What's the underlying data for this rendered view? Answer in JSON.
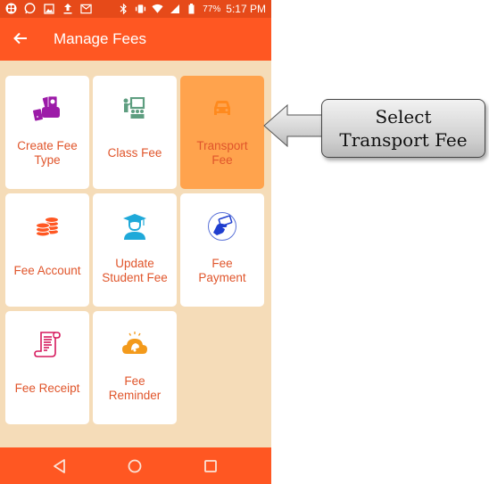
{
  "status_bar": {
    "left_icons": [
      "app-notification-icon",
      "whatsapp-icon",
      "image-icon",
      "upload-icon",
      "mail-icon"
    ],
    "right_icons": [
      "bluetooth-icon",
      "vibrate-icon",
      "wifi-icon",
      "signal-icon",
      "battery-icon"
    ],
    "battery": "77%",
    "time": "5:17 PM"
  },
  "app_bar": {
    "back_icon": "arrow-left-icon",
    "title": "Manage Fees"
  },
  "tiles": [
    {
      "label_line1": "Create Fee",
      "label_line2": "Type",
      "icon": "cash-hand-icon",
      "icon_color": "#9C1AA8"
    },
    {
      "label_line1": "Class Fee",
      "label_line2": "",
      "icon": "classroom-icon",
      "icon_color": "#5E9E80"
    },
    {
      "label_line1": "Transport",
      "label_line2": "Fee",
      "icon": "car-icon",
      "icon_color": "#FF8A1E",
      "selected": true
    },
    {
      "label_line1": "Fee Account",
      "label_line2": "",
      "icon": "coins-icon",
      "icon_color": "#FF5722"
    },
    {
      "label_line1": "Update",
      "label_line2": "Student Fee",
      "icon": "graduate-icon",
      "icon_color": "#1FA9D9"
    },
    {
      "label_line1": "Fee",
      "label_line2": "Payment",
      "icon": "card-payment-icon",
      "icon_color": "#1F3ECF"
    },
    {
      "label_line1": "Fee Receipt",
      "label_line2": "",
      "icon": "receipt-scroll-icon",
      "icon_color": "#D6195D"
    },
    {
      "label_line1": "Fee",
      "label_line2": "Reminder",
      "icon": "cloud-bell-icon",
      "icon_color": "#F39A1B"
    }
  ],
  "nav_bar": {
    "back": "back-triangle-icon",
    "home": "home-circle-icon",
    "recents": "recents-square-icon"
  },
  "callout": {
    "line1": "Select",
    "line2": "Transport Fee"
  },
  "colors": {
    "status_bar": "#E64A19",
    "app_bar": "#FF5722",
    "background": "#F5DCB8",
    "selected_tile": "#FFA34D",
    "label_text": "#E0552B"
  }
}
